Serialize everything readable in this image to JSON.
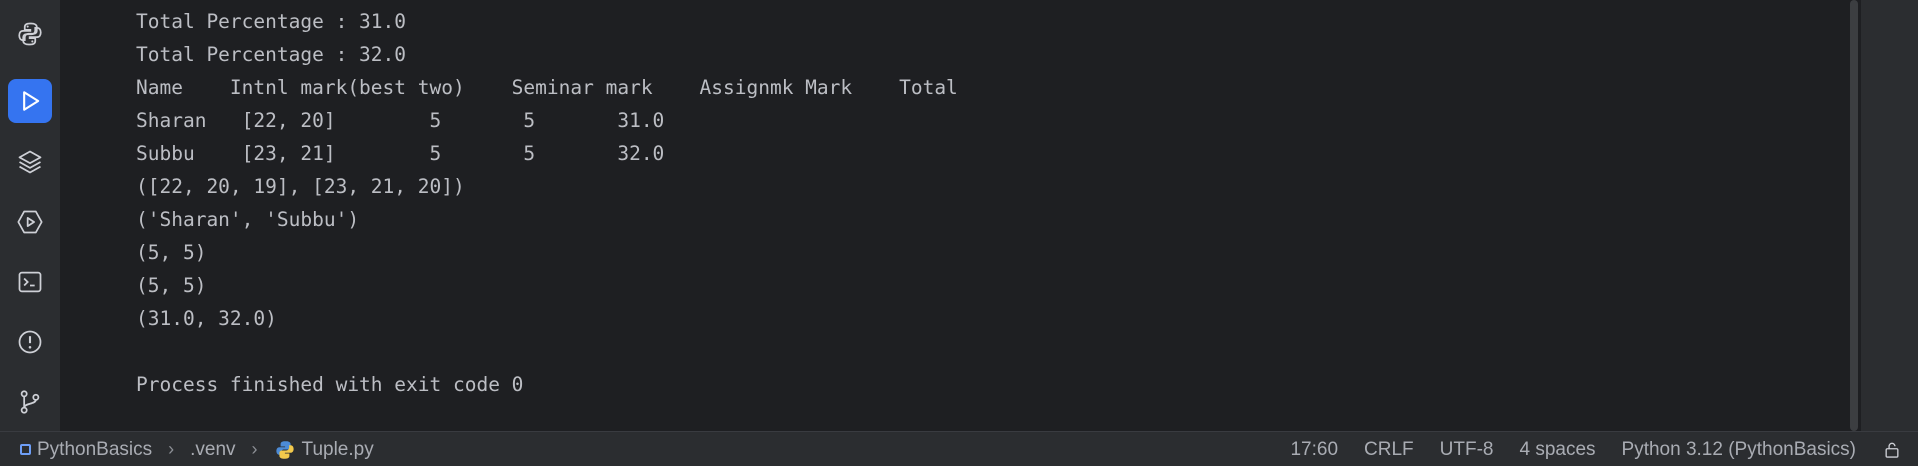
{
  "toolstrip": {
    "tools": [
      {
        "name": "python-console",
        "icon": "python-icon",
        "active": false
      },
      {
        "name": "run",
        "icon": "run-icon",
        "active": true
      },
      {
        "name": "layers",
        "icon": "layers-icon",
        "active": false
      },
      {
        "name": "services",
        "icon": "services-icon",
        "active": false
      },
      {
        "name": "terminal",
        "icon": "terminal-icon",
        "active": false
      },
      {
        "name": "problems",
        "icon": "problems-icon",
        "active": false
      },
      {
        "name": "version-control",
        "icon": "git-icon",
        "active": false
      }
    ]
  },
  "console": {
    "lines": [
      "Total Percentage : 31.0",
      "Total Percentage : 32.0",
      "Name    Intnl mark(best two)    Seminar mark    Assignmk Mark    Total",
      "Sharan   [22, 20]        5       5       31.0",
      "Subbu    [23, 21]        5       5       32.0",
      "([22, 20, 19], [23, 21, 20])",
      "('Sharan', 'Subbu')",
      "(5, 5)",
      "(5, 5)",
      "(31.0, 32.0)",
      "",
      "Process finished with exit code 0"
    ]
  },
  "statusbar": {
    "breadcrumbs": [
      {
        "label": "PythonBasics",
        "icon": "module-icon"
      },
      {
        "label": ".venv",
        "icon": ""
      },
      {
        "label": "Tuple.py",
        "icon": "python-file-icon"
      }
    ],
    "position": "17:60",
    "line_separator": "CRLF",
    "encoding": "UTF-8",
    "indent": "4 spaces",
    "interpreter": "Python 3.12 (PythonBasics)",
    "colors": {
      "accent": "#3574f0",
      "panel": "#2b2d30",
      "editor_bg": "#1e1f22",
      "text": "#bcbec4"
    }
  }
}
